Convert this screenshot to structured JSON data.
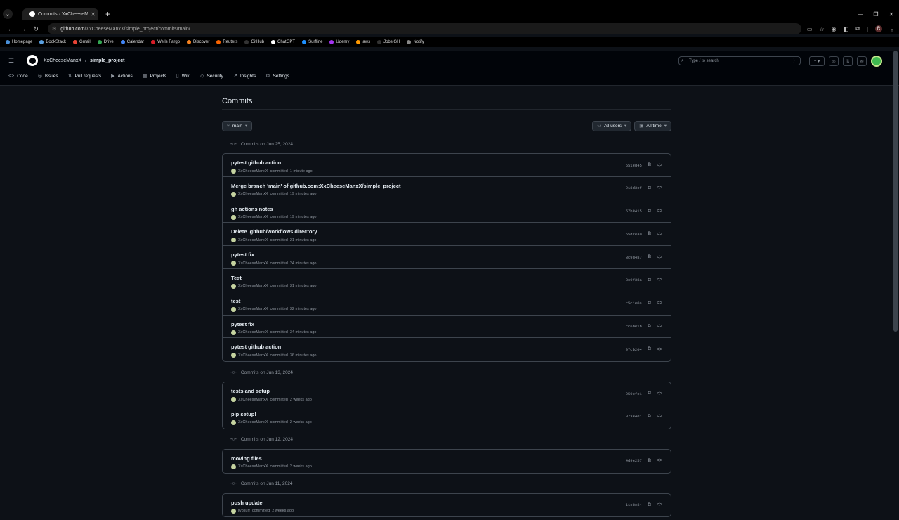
{
  "browser": {
    "tab_title": "Commits · XxCheeseManxX/si",
    "url_host": "github.com",
    "url_path": "/XxCheeseManxX/simple_project/commits/main/",
    "profile_initial": "R"
  },
  "bookmarks": [
    {
      "label": "Homepage",
      "color": "#4a90d9"
    },
    {
      "label": "BookStack",
      "color": "#5aa0e0"
    },
    {
      "label": "Gmail",
      "color": "#ea4335"
    },
    {
      "label": "Drive",
      "color": "#34a853"
    },
    {
      "label": "Calendar",
      "color": "#4285f4"
    },
    {
      "label": "Wells Fargo",
      "color": "#d71e28"
    },
    {
      "label": "Discover",
      "color": "#f58220"
    },
    {
      "label": "Reuters",
      "color": "#fa6400"
    },
    {
      "label": "GitHub",
      "color": "#333333"
    },
    {
      "label": "ChatGPT",
      "color": "#ffffff"
    },
    {
      "label": "Surfline",
      "color": "#1e90ff"
    },
    {
      "label": "Udemy",
      "color": "#a435f0"
    },
    {
      "label": "aws",
      "color": "#ff9900"
    },
    {
      "label": "Jobs GH",
      "color": "#333333"
    },
    {
      "label": "Notify",
      "color": "#888888"
    }
  ],
  "header": {
    "owner": "XxCheeseManxX",
    "separator": "/",
    "repo": "simple_project",
    "search_placeholder": "Type / to search"
  },
  "repo_nav": [
    {
      "label": "Code",
      "icon": "code-icon",
      "glyph": "<>"
    },
    {
      "label": "Issues",
      "icon": "issue-icon",
      "glyph": "◎"
    },
    {
      "label": "Pull requests",
      "icon": "pull-request-icon",
      "glyph": "⇅"
    },
    {
      "label": "Actions",
      "icon": "actions-icon",
      "glyph": "▶"
    },
    {
      "label": "Projects",
      "icon": "projects-icon",
      "glyph": "▦"
    },
    {
      "label": "Wiki",
      "icon": "wiki-icon",
      "glyph": "▯"
    },
    {
      "label": "Security",
      "icon": "shield-icon",
      "glyph": "◇"
    },
    {
      "label": "Insights",
      "icon": "graph-icon",
      "glyph": "↗"
    },
    {
      "label": "Settings",
      "icon": "gear-icon",
      "glyph": "⚙"
    }
  ],
  "main": {
    "title": "Commits",
    "branch": "main",
    "users_filter": "All users",
    "time_filter": "All time"
  },
  "groups": [
    {
      "heading": "Commits on Jun 25, 2024",
      "commits": [
        {
          "message": "pytest github action",
          "author": "XxCheeseManxX",
          "verb": "committed",
          "time": "1 minute ago",
          "sha": "551ed45"
        },
        {
          "message": "Merge branch 'main' of github.com:XxCheeseManxX/simple_project",
          "author": "XxCheeseManxX",
          "verb": "committed",
          "time": "19 minutes ago",
          "sha": "218d3ef"
        },
        {
          "message": "gh actions notes",
          "author": "XxCheeseManxX",
          "verb": "committed",
          "time": "19 minutes ago",
          "sha": "57b8415"
        },
        {
          "message": "Delete .github/workflows directory",
          "author": "XxCheeseManxX",
          "verb": "committed",
          "time": "21 minutes ago",
          "sha": "55dcea0"
        },
        {
          "message": "pytest fix",
          "author": "XxCheeseManxX",
          "verb": "committed",
          "time": "24 minutes ago",
          "sha": "3c9d487"
        },
        {
          "message": "Test",
          "author": "XxCheeseManxX",
          "verb": "committed",
          "time": "31 minutes ago",
          "sha": "8c0f38a"
        },
        {
          "message": "test",
          "author": "XxCheeseManxX",
          "verb": "committed",
          "time": "32 minutes ago",
          "sha": "c5c1e0a"
        },
        {
          "message": "pytest fix",
          "author": "XxCheeseManxX",
          "verb": "committed",
          "time": "34 minutes ago",
          "sha": "cc6be1b"
        },
        {
          "message": "pytest github action",
          "author": "XxCheeseManxX",
          "verb": "committed",
          "time": "36 minutes ago",
          "sha": "07cb204"
        }
      ]
    },
    {
      "heading": "Commits on Jun 13, 2024",
      "commits": [
        {
          "message": "tests and setup",
          "author": "XxCheeseManxX",
          "verb": "committed",
          "time": "2 weeks ago",
          "sha": "050efe1"
        },
        {
          "message": "pip setup!",
          "author": "XxCheeseManxX",
          "verb": "committed",
          "time": "2 weeks ago",
          "sha": "073e4e1"
        }
      ]
    },
    {
      "heading": "Commits on Jun 12, 2024",
      "commits": [
        {
          "message": "moving files",
          "author": "XxCheeseManxX",
          "verb": "committed",
          "time": "2 weeks ago",
          "sha": "4d9e257"
        }
      ]
    },
    {
      "heading": "Commits on Jun 11, 2024",
      "commits": [
        {
          "message": "push update",
          "author": "rvpsurf",
          "verb": "committed",
          "time": "2 weeks ago",
          "sha": "11c8e34"
        }
      ]
    }
  ]
}
